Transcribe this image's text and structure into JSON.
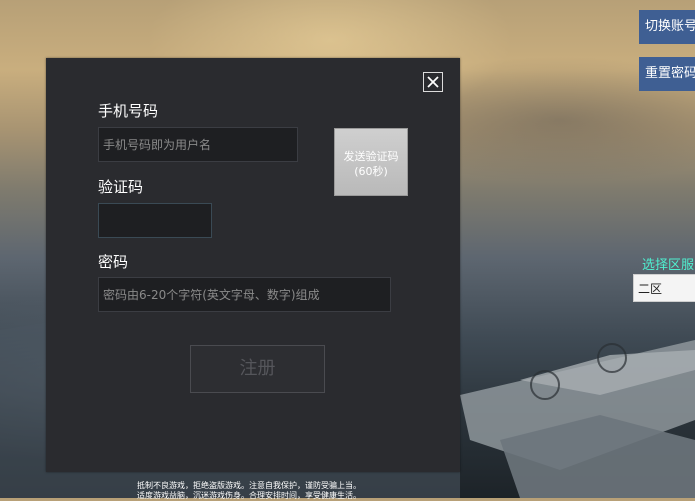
{
  "side_buttons": {
    "switch_account": "切换账号",
    "reset_password": "重置密码"
  },
  "server": {
    "label": "选择区服",
    "selected": "二区"
  },
  "register_form": {
    "phone_label": "手机号码",
    "phone_placeholder": "手机号码即为用户名",
    "code_label": "验证码",
    "code_value": "",
    "send_code_line1": "发送验证码",
    "send_code_line2": "(60秒)",
    "password_label": "密码",
    "password_placeholder": "密码由6-20个字符(英文字母、数字)组成",
    "register_button": "注册"
  },
  "notice": {
    "line1": "抵制不良游戏，拒绝盗版游戏。注意自我保护，谨防受骗上当。",
    "line2": "适度游戏益脑，沉迷游戏伤身。合理安排时间，享受健康生活。"
  },
  "colors": {
    "panel_bg": "#2a2b2f",
    "side_button_bg": "#3f5f93",
    "server_label": "#4ff0d0"
  }
}
